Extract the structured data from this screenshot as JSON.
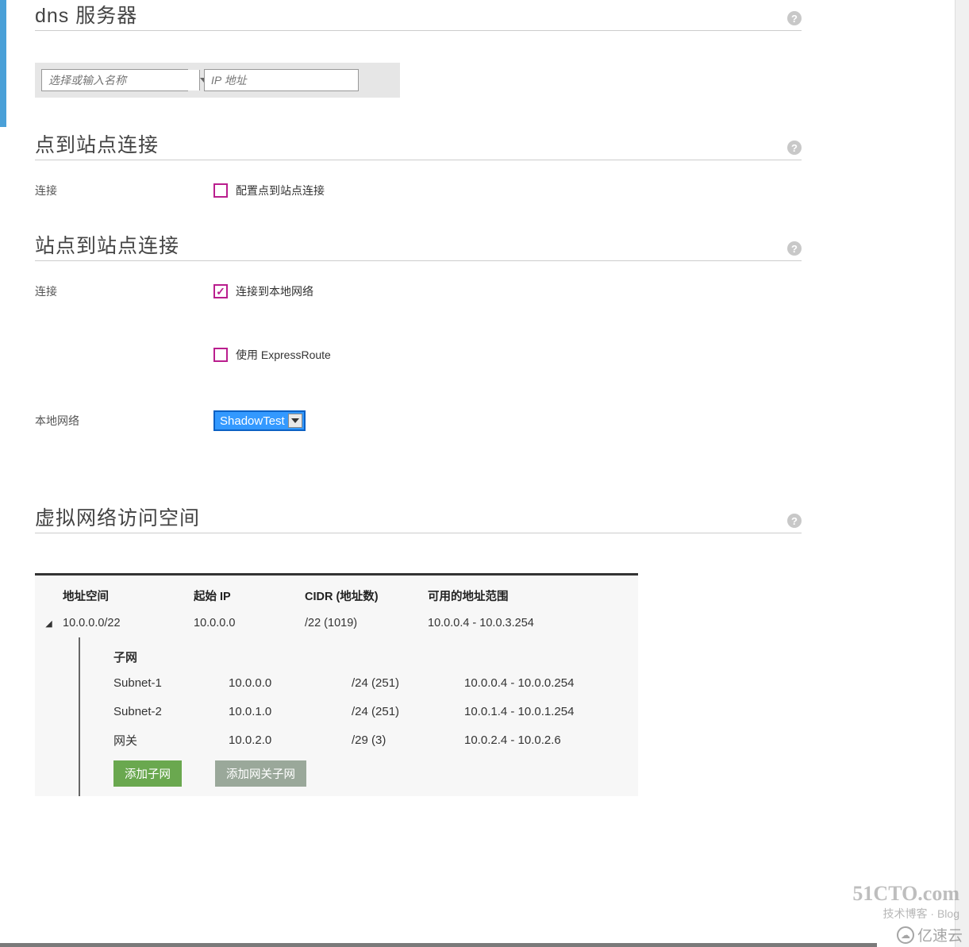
{
  "dns": {
    "title": "dns 服务器",
    "name_placeholder": "选择或输入名称",
    "ip_placeholder": "IP 地址"
  },
  "p2s": {
    "title": "点到站点连接",
    "conn_label": "连接",
    "checkbox_label": "配置点到站点连接"
  },
  "s2s": {
    "title": "站点到站点连接",
    "conn_label": "连接",
    "connect_local_label": "连接到本地网络",
    "expressroute_label": "使用 ExpressRoute",
    "local_net_label": "本地网络",
    "local_net_value": "ShadowTest"
  },
  "vnet": {
    "title": "虚拟网络访问空间",
    "headers": {
      "addr_space": "地址空间",
      "start_ip": "起始 IP",
      "cidr": "CIDR (地址数)",
      "range": "可用的地址范围"
    },
    "row": {
      "addr_space": "10.0.0.0/22",
      "start_ip": "10.0.0.0",
      "cidr": "/22 (1019)",
      "range": "10.0.0.4 - 10.0.3.254"
    },
    "subnet_title": "子网",
    "subnets": [
      {
        "name": "Subnet-1",
        "start_ip": "10.0.0.0",
        "cidr": "/24 (251)",
        "range": "10.0.0.4 - 10.0.0.254"
      },
      {
        "name": "Subnet-2",
        "start_ip": "10.0.1.0",
        "cidr": "/24 (251)",
        "range": "10.0.1.4 - 10.0.1.254"
      },
      {
        "name": "网关",
        "start_ip": "10.0.2.0",
        "cidr": "/29 (3)",
        "range": "10.0.2.4 - 10.0.2.6"
      }
    ],
    "add_subnet": "添加子网",
    "add_gateway_subnet": "添加网关子网"
  },
  "watermarks": {
    "site": "51CTO.com",
    "sub": "技术博客 · Blog",
    "yisu": "亿速云"
  }
}
